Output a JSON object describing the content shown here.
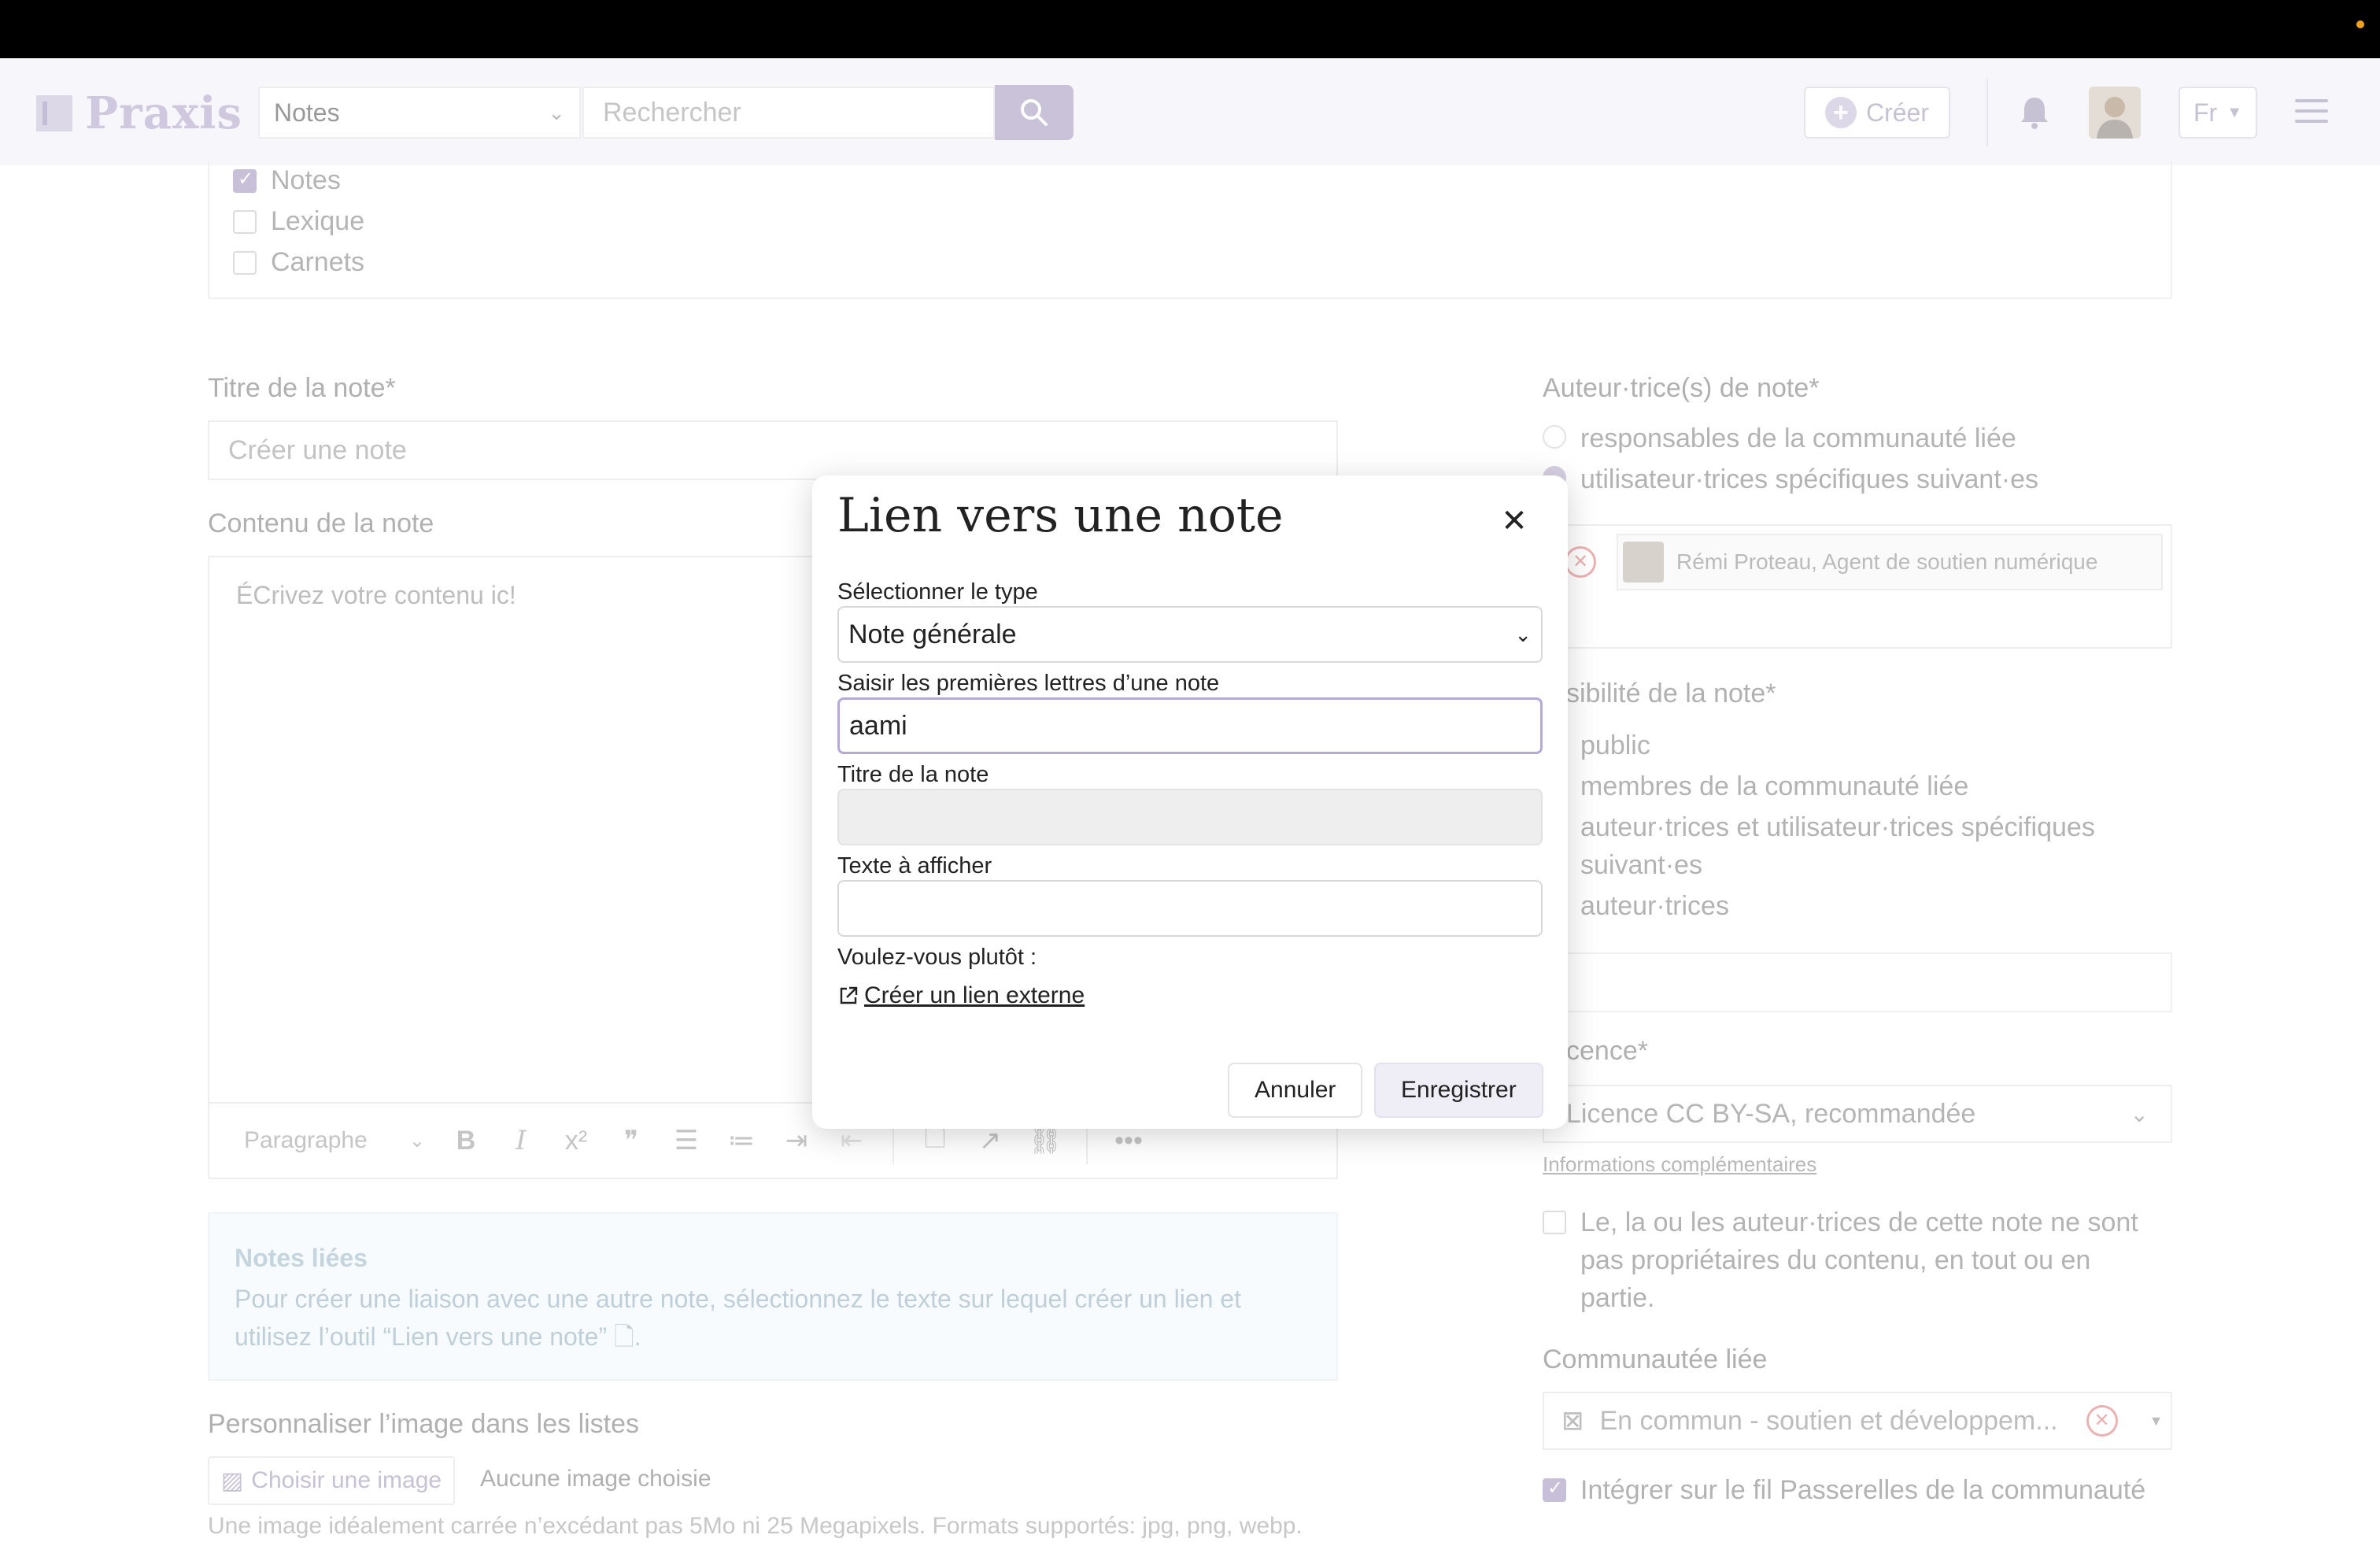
{
  "header": {
    "logo_text": "Praxis",
    "scope_select": "Notes",
    "search_placeholder": "Rechercher",
    "create_label": "Créer",
    "lang_label": "Fr"
  },
  "filters": {
    "items": [
      {
        "label": "Notes",
        "checked": true
      },
      {
        "label": "Lexique",
        "checked": false
      },
      {
        "label": "Carnets",
        "checked": false
      }
    ]
  },
  "form": {
    "title_label": "Titre de la note*",
    "title_placeholder": "Créer une note",
    "content_label": "Contenu de la note",
    "content_placeholder": "ÉCrivez votre contenu ic!",
    "toolbar": {
      "block_select": "Paragraphe"
    },
    "linked_notes": {
      "title": "Notes liées",
      "text": "Pour créer une liaison avec une autre note, sélectionnez le texte sur lequel créer un lien et utilisez l’outil “Lien vers une note”",
      "text_end": "."
    },
    "image_label": "Personnaliser l’image dans les listes",
    "image_button": "Choisir une image",
    "image_status": "Aucune image choisie",
    "image_hint": "Une image idéalement carrée n’excédant pas 5Mo ni 25 Megapixels. Formats supportés: jpg, png, webp."
  },
  "side": {
    "authors_label": "Auteur·trice(s) de note*",
    "authors_options": [
      "responsables de la communauté liée",
      "utilisateur·trices spécifiques suivant·es"
    ],
    "author_chip": "Rémi Proteau, Agent de soutien numérique",
    "visibility_label": "sibilité de la note*",
    "visibility_options": [
      "public",
      "membres de la communauté liée",
      "auteur·trices et utilisateur·trices spécifiques",
      "suivant·es",
      "auteur·trices"
    ],
    "licence_label": "cence*",
    "licence_value": "Licence CC BY-SA, recommandée",
    "info_link": "Informations complémentaires",
    "ownership_text": [
      "Le, la ou les auteur·trices de cette note ne sont",
      "pas propriétaires du contenu, en tout ou en",
      "partie."
    ],
    "community_label": "Communautée liée",
    "community_value": "En commun - soutien et développem...",
    "integrate_label": "Intégrer sur le fil Passerelles de la communauté"
  },
  "modal": {
    "title": "Lien vers une note",
    "type_label": "Sélectionner le type",
    "type_value": "Note générale",
    "search_label": "Saisir les premières lettres d’une note",
    "search_value": "aami",
    "note_title_label": "Titre de la note",
    "note_title_value": "",
    "display_text_label": "Texte à afficher",
    "display_text_value": "",
    "alt_prompt": "Voulez-vous plutôt :",
    "external_link": "Créer un lien externe",
    "cancel": "Annuler",
    "save": "Enregistrer"
  }
}
